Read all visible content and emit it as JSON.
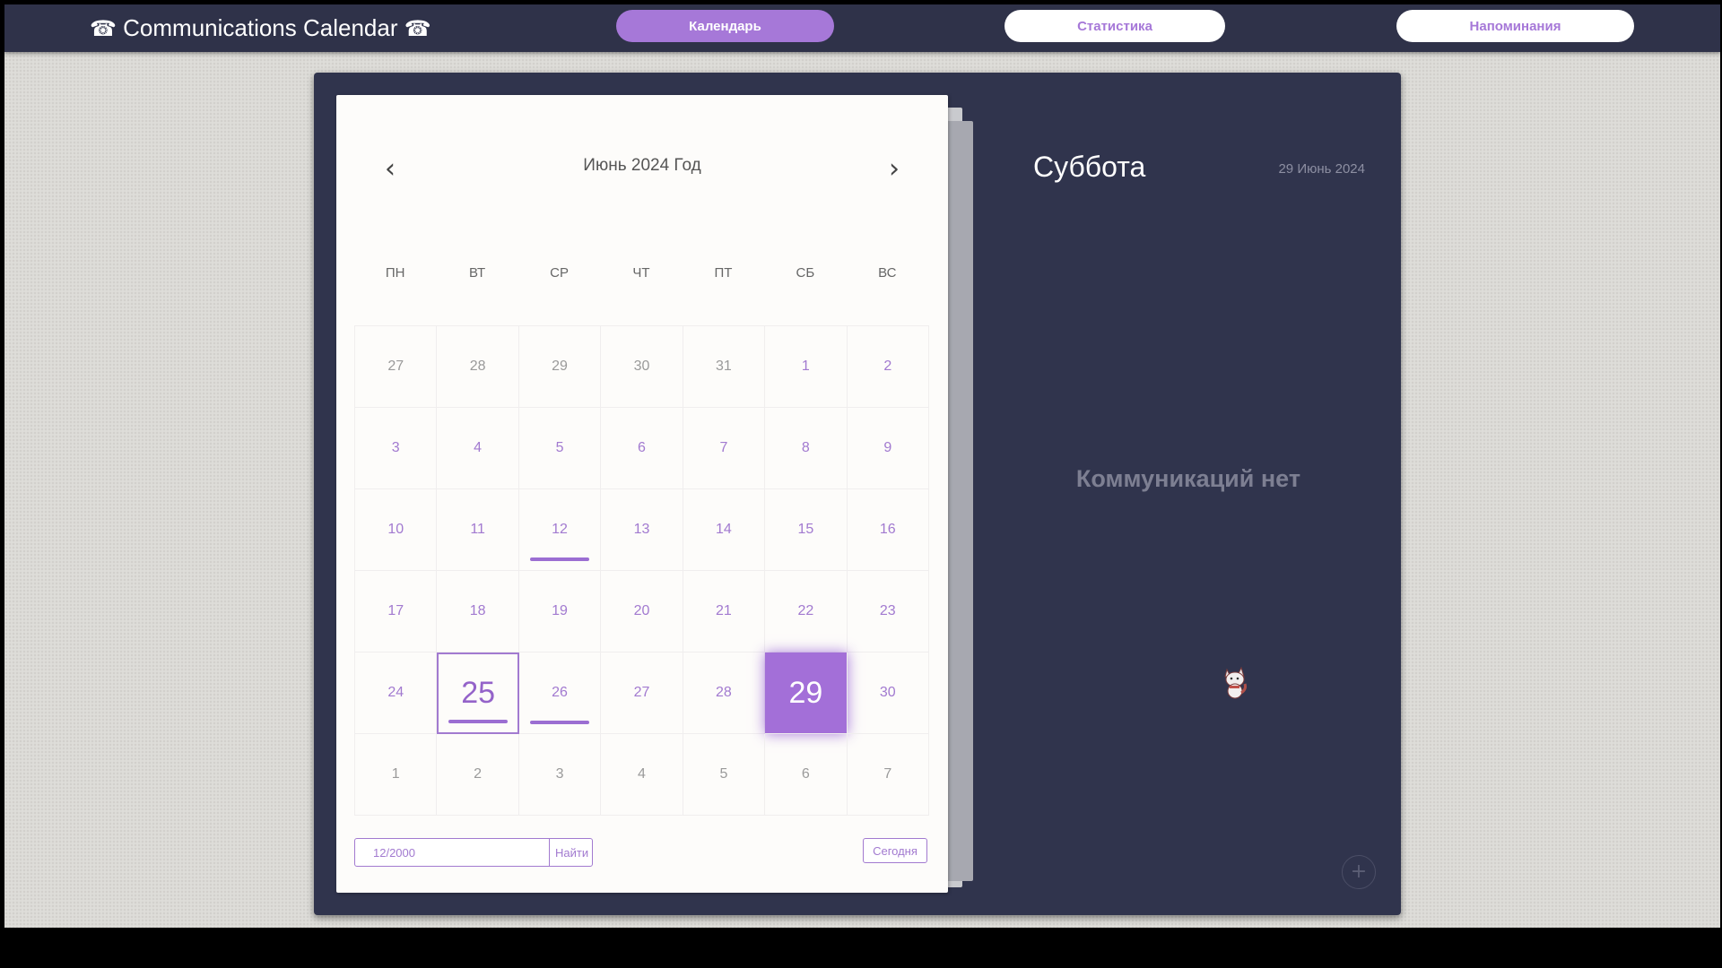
{
  "header": {
    "brand": "Communications Calendar",
    "brand_icon": "☎",
    "nav": [
      {
        "label": "Календарь",
        "active": true
      },
      {
        "label": "Статистика",
        "active": false
      },
      {
        "label": "Напоминания",
        "active": false
      }
    ]
  },
  "calendar": {
    "month_title": "Июнь 2024 Год",
    "prev_icon": "chevron-left-icon",
    "next_icon": "chevron-right-icon",
    "weekdays": [
      "ПН",
      "ВТ",
      "СР",
      "ЧТ",
      "ПТ",
      "СБ",
      "ВС"
    ],
    "weeks": [
      [
        "27",
        "28",
        "29",
        "30",
        "31",
        "1",
        "2"
      ],
      [
        "3",
        "4",
        "5",
        "6",
        "7",
        "8",
        "9"
      ],
      [
        "10",
        "11",
        "12",
        "13",
        "14",
        "15",
        "16"
      ],
      [
        "17",
        "18",
        "19",
        "20",
        "21",
        "22",
        "23"
      ],
      [
        "24",
        "25",
        "26",
        "27",
        "28",
        "29",
        "30"
      ],
      [
        "1",
        "2",
        "3",
        "4",
        "5",
        "6",
        "7"
      ]
    ],
    "today": "25",
    "selected": "29",
    "days_with_events": [
      "12",
      "25",
      "26"
    ],
    "search_placeholder": "12/2000",
    "search_button": "Найти",
    "today_button": "Сегодня"
  },
  "day_panel": {
    "weekday": "Суббота",
    "date": "29 Июнь 2024",
    "empty_message": "Коммуникаций нет",
    "add_label": "+"
  },
  "colors": {
    "accent": "#a678d8",
    "topbar": "#2f3249",
    "panel": "#30344d"
  }
}
